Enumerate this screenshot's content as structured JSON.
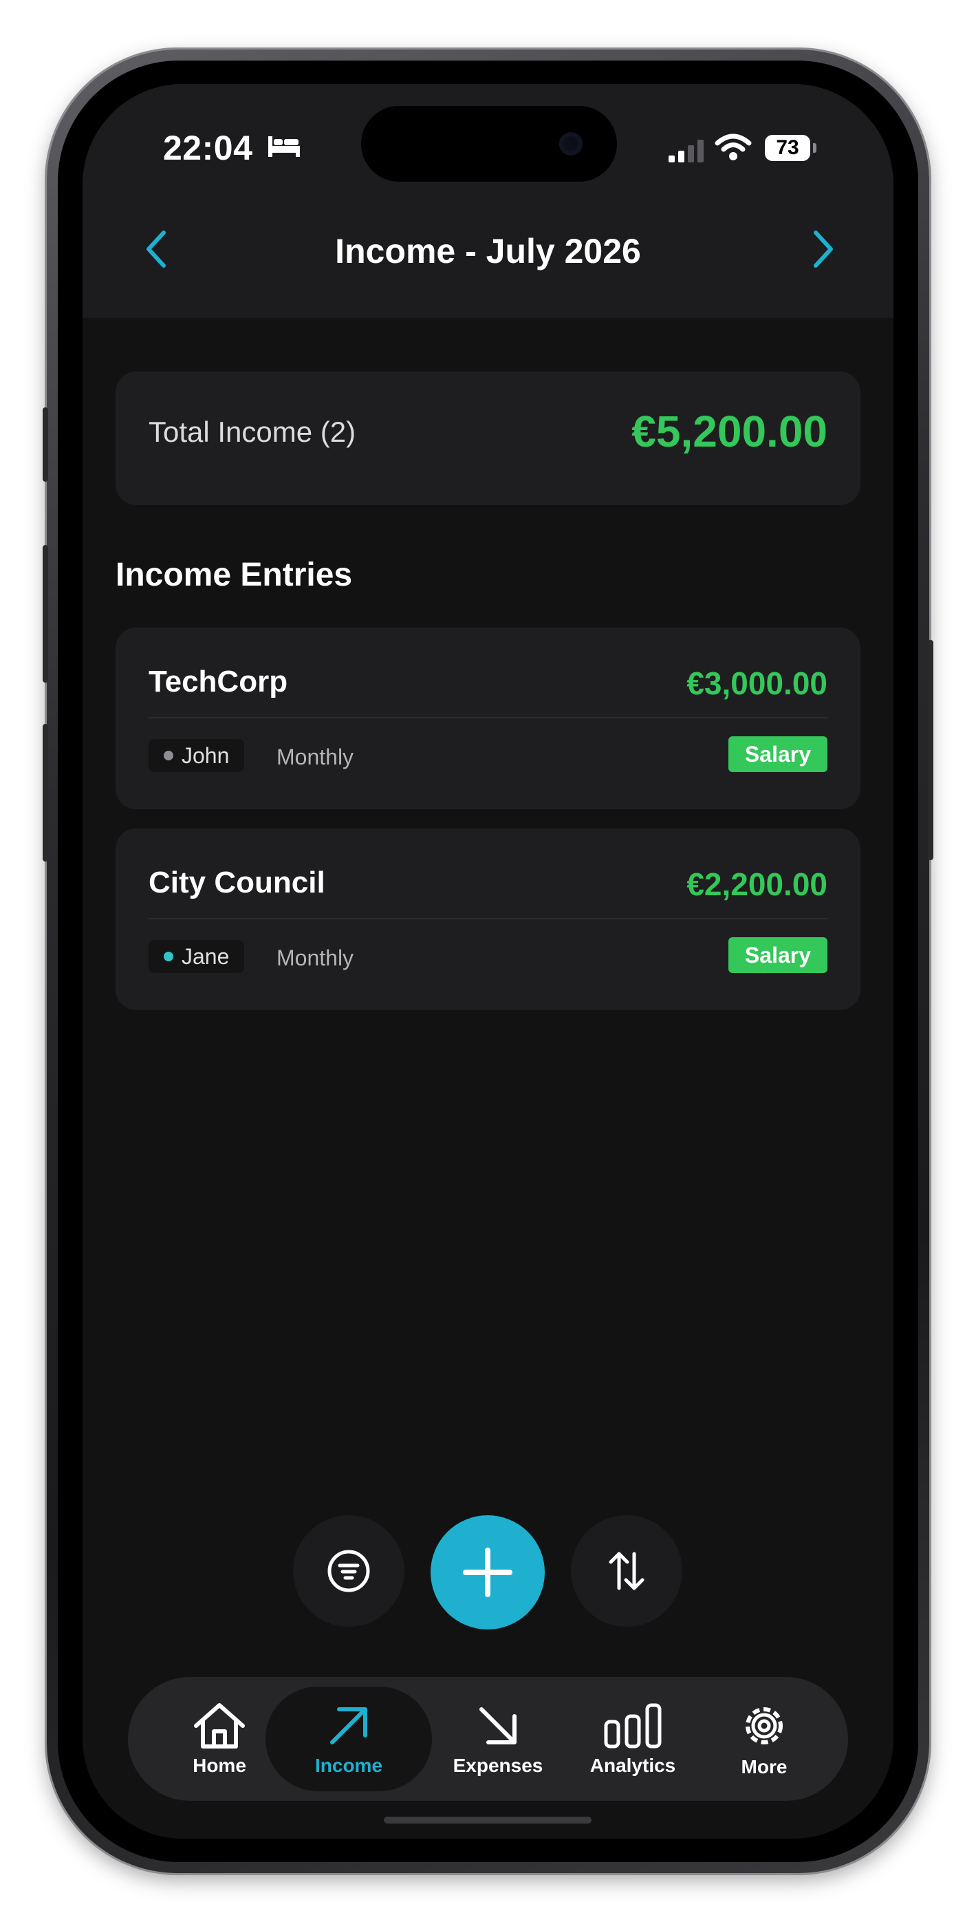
{
  "status_bar": {
    "time": "22:04",
    "focus_icon": "bed-icon",
    "battery": "73"
  },
  "header": {
    "title": "Income - July 2026"
  },
  "summary": {
    "label": "Total Income (2)",
    "amount": "€5,200.00"
  },
  "section_title": "Income Entries",
  "entries": [
    {
      "name": "TechCorp",
      "amount": "€3,000.00",
      "person": "John",
      "frequency": "Monthly",
      "category": "Salary",
      "person_color": "#8e8e93"
    },
    {
      "name": "City Council",
      "amount": "€2,200.00",
      "person": "Jane",
      "frequency": "Monthly",
      "category": "Salary",
      "person_color": "#36c2c9"
    }
  ],
  "tabs": [
    {
      "label": "Home",
      "icon": "home-icon"
    },
    {
      "label": "Income",
      "icon": "arrow-up-right-icon"
    },
    {
      "label": "Expenses",
      "icon": "arrow-down-right-icon"
    },
    {
      "label": "Analytics",
      "icon": "bar-chart-icon"
    },
    {
      "label": "More",
      "icon": "gear-icon"
    }
  ],
  "colors": {
    "accent": "#1fb0cf",
    "income_green": "#34c759",
    "background": "#121213",
    "card": "#1e1e20"
  }
}
